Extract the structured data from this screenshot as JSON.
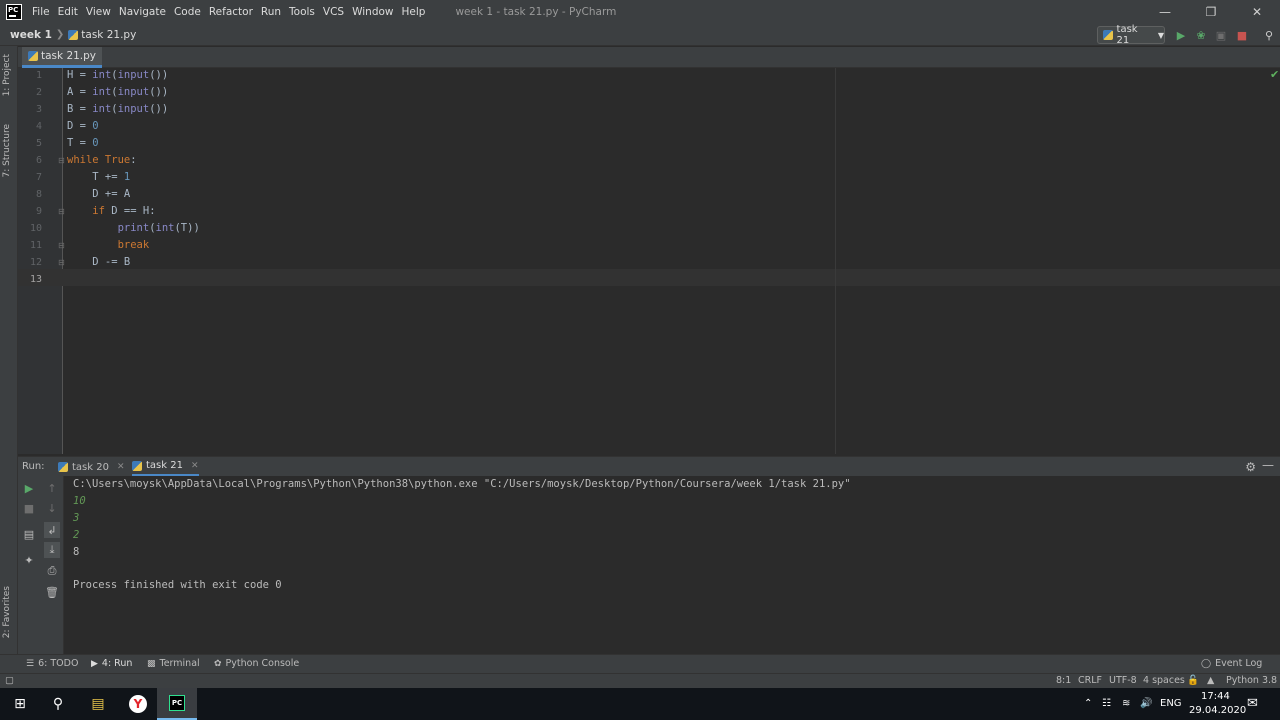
{
  "window": {
    "title": "week 1 - task 21.py - PyCharm",
    "app_logo": "PC"
  },
  "menu": [
    "File",
    "Edit",
    "View",
    "Navigate",
    "Code",
    "Refactor",
    "Run",
    "Tools",
    "VCS",
    "Window",
    "Help"
  ],
  "navbar": {
    "project": "week 1",
    "file": "task 21.py",
    "run_config": "task 21"
  },
  "left_strip": {
    "project": "1: Project",
    "structure": "7: Structure",
    "favorites": "2: Favorites"
  },
  "editor": {
    "tab": "task 21.py",
    "line_numbers": [
      "1",
      "2",
      "3",
      "4",
      "5",
      "6",
      "7",
      "8",
      "9",
      "10",
      "11",
      "12",
      "13"
    ],
    "current_line": "13"
  },
  "run": {
    "label": "Run:",
    "tabs": [
      "task 20",
      "task 21"
    ],
    "console": {
      "command": "C:\\Users\\moysk\\AppData\\Local\\Programs\\Python\\Python38\\python.exe \"C:/Users/moysk/Desktop/Python/Coursera/week 1/task 21.py\"",
      "inputs": [
        "10",
        "3",
        "2"
      ],
      "output": "8",
      "finished": "Process finished with exit code 0"
    }
  },
  "bottom_tools": {
    "todo": "6: TODO",
    "run": "4: Run",
    "terminal": "Terminal",
    "python_console": "Python Console",
    "event_log": "Event Log"
  },
  "status": {
    "position": "8:1",
    "line_sep": "CRLF",
    "encoding": "UTF-8",
    "indent": "4 spaces",
    "interpreter": "Python 3.8"
  },
  "taskbar": {
    "lang": "ENG",
    "time": "17:44",
    "date": "29.04.2020"
  },
  "colors": {
    "keyword": "#cc7832",
    "builtin": "#8888c6",
    "number": "#6897bb",
    "text": "#a9b7c6",
    "input": "#629755",
    "accent": "#4a88c7"
  }
}
